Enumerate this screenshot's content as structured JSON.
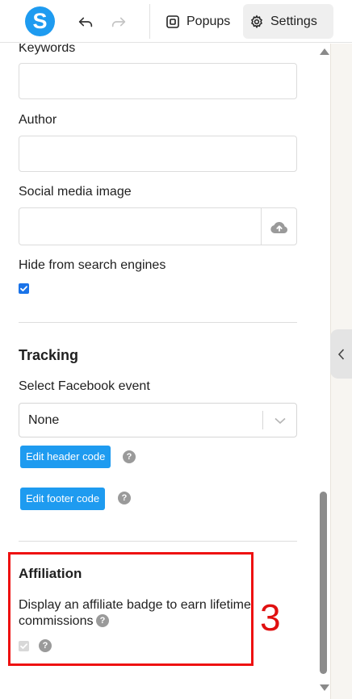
{
  "toolbar": {
    "logo_letter": "S",
    "popups_label": "Popups",
    "settings_label": "Settings"
  },
  "fields": {
    "keywords_label": "Keywords",
    "author_label": "Author",
    "social_image_label": "Social media image",
    "hide_label": "Hide from search engines",
    "hide_checked": true
  },
  "tracking": {
    "title": "Tracking",
    "select_label": "Select Facebook event",
    "select_value": "None",
    "header_btn": "Edit header code",
    "footer_btn": "Edit footer code"
  },
  "affiliation": {
    "title": "Affiliation",
    "description": "Display an affiliate badge to earn lifetime commissions",
    "checked": true,
    "disabled": true
  },
  "annotation": {
    "number": "3",
    "color": "#ee1111"
  },
  "colors": {
    "accent": "#1e9bf0",
    "checkbox_on": "#1a73e8"
  },
  "help_glyph": "?"
}
